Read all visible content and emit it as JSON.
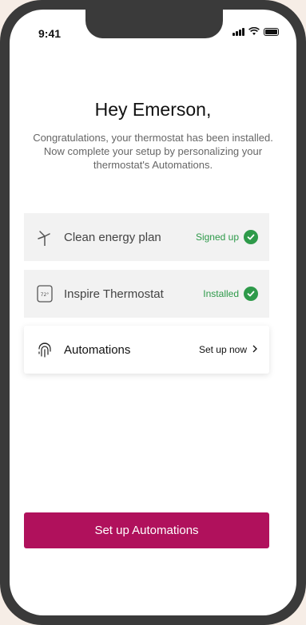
{
  "status_bar": {
    "time": "9:41"
  },
  "greeting": "Hey Emerson,",
  "subtitle": "Congratulations, your thermostat has been installed. Now complete your setup by personalizing your thermostat's Automations.",
  "checklist": [
    {
      "label": "Clean energy plan",
      "status": "Signed up",
      "state": "done",
      "icon": "wind-turbine-icon"
    },
    {
      "label": "Inspire Thermostat",
      "status": "Installed",
      "state": "done",
      "icon": "thermostat-icon"
    },
    {
      "label": "Automations",
      "status": "Set up now",
      "state": "todo",
      "icon": "fingerprint-icon"
    }
  ],
  "cta": {
    "label": "Set up Automations"
  },
  "colors": {
    "accent": "#b0115c",
    "success": "#2e9a4a",
    "background": "#f6ede6"
  }
}
